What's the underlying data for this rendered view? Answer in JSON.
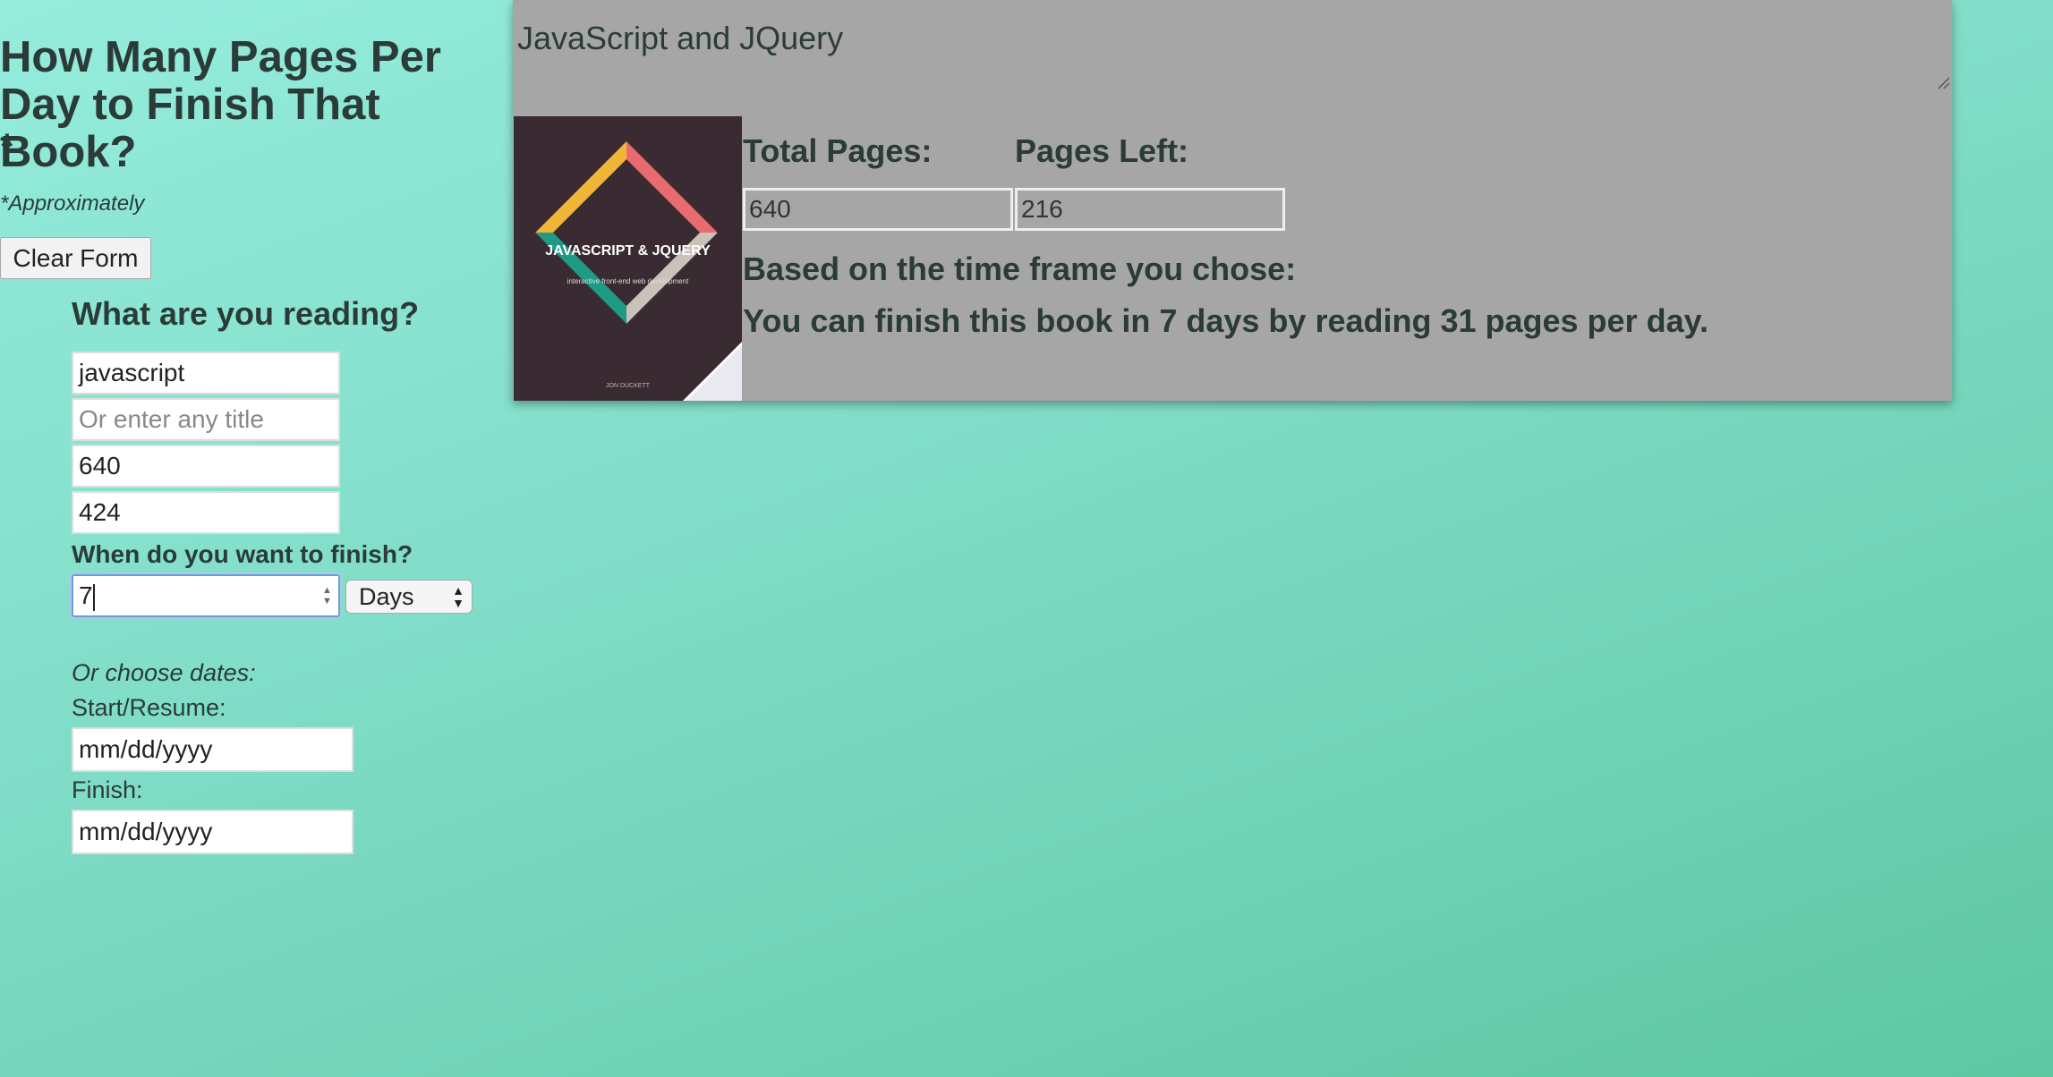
{
  "header": {
    "title": "How Many Pages Per Day to Finish That Book?",
    "asterisk": "*",
    "note": "*Approximately"
  },
  "form": {
    "clear_label": "Clear Form",
    "reading_question": "What are you reading?",
    "book_select_value": "javascript",
    "title_placeholder": "Or enter any title",
    "total_pages_value": "640",
    "pages_read_value": "424",
    "finish_question": "When do you want to finish?",
    "duration_value": "7",
    "unit_value": "Days",
    "or_dates": "Or choose dates:",
    "start_label": "Start/Resume:",
    "start_placeholder": "mm/dd/yyyy",
    "finish_label": "Finish:",
    "finish_placeholder": "mm/dd/yyyy"
  },
  "result": {
    "book_title": "JavaScript and JQuery",
    "cover_title": "JAVASCRIPT & JQUERY",
    "cover_subtitle": "interactive front-end web development",
    "cover_author": "JON DUCKETT",
    "total_pages_label": "Total Pages:",
    "total_pages_value": "640",
    "pages_left_label": "Pages Left:",
    "pages_left_value": "216",
    "based_on": "Based on the time frame you chose:",
    "summary": "You can finish this book in 7 days by reading 31 pages per day."
  },
  "colors": {
    "background_start": "#95ecdc",
    "background_end": "#5ec7a2",
    "panel": "#a6a6a6",
    "text": "#2b3b37"
  }
}
